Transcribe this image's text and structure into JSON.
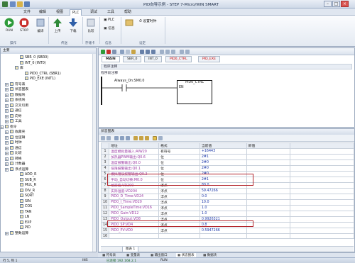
{
  "window": {
    "title": "PID向导示例 - STEP 7-Micro/WIN SMART"
  },
  "menu_tabs": [
    "文件",
    "编辑",
    "视图",
    "PLC",
    "调试",
    "工具",
    "帮助"
  ],
  "ribbon": {
    "run_label": "RUN",
    "stop_label": "STOP",
    "compile_label": "编译",
    "upload_label": "上传",
    "download_label": "下载",
    "compare_label": "比较",
    "plc_label": "PLC",
    "info_label": "信息",
    "settings_label": "设置时钟",
    "group_operation": "操作",
    "group_transfer": "传送",
    "group_memory": "存储卡",
    "group_info": "信息",
    "group_settings": "设定"
  },
  "left_panel": {
    "header": "主要",
    "tree": [
      {
        "label": "SBR_0 (SBR0)",
        "indent": 3
      },
      {
        "label": "INT_0 (INT0)",
        "indent": 3
      },
      {
        "label": "库",
        "indent": 2
      },
      {
        "label": "PID0_CTRL (SBR1)",
        "indent": 4
      },
      {
        "label": "PID_EXE (INT1)",
        "indent": 4
      },
      {
        "label": "符号表",
        "indent": 1
      },
      {
        "label": "状态图表",
        "indent": 1
      },
      {
        "label": "数据块",
        "indent": 1
      },
      {
        "label": "系统块",
        "indent": 1
      },
      {
        "label": "交叉引用",
        "indent": 1
      },
      {
        "label": "通信",
        "indent": 1
      },
      {
        "label": "向导",
        "indent": 1
      },
      {
        "label": "工具",
        "indent": 1
      },
      {
        "label": "指令",
        "indent": 0
      },
      {
        "label": "收藏夹",
        "indent": 1
      },
      {
        "label": "位逻辑",
        "indent": 1
      },
      {
        "label": "时钟",
        "indent": 1
      },
      {
        "label": "通信",
        "indent": 1
      },
      {
        "label": "比较",
        "indent": 1
      },
      {
        "label": "转换",
        "indent": 1
      },
      {
        "label": "计数器",
        "indent": 1
      },
      {
        "label": "浮点运算",
        "indent": 1
      },
      {
        "label": "ADD_R",
        "indent": 3
      },
      {
        "label": "SUB_R",
        "indent": 3
      },
      {
        "label": "MUL_R",
        "indent": 3
      },
      {
        "label": "DIV_R",
        "indent": 3
      },
      {
        "label": "SQRT",
        "indent": 3
      },
      {
        "label": "SIN",
        "indent": 3
      },
      {
        "label": "COS",
        "indent": 3
      },
      {
        "label": "TAN",
        "indent": 3
      },
      {
        "label": "LN",
        "indent": 3
      },
      {
        "label": "EXP",
        "indent": 3
      },
      {
        "label": "PID",
        "indent": 3
      },
      {
        "label": "整数运算",
        "indent": 1
      }
    ]
  },
  "editor": {
    "tabs": [
      "MAIN",
      "SBR_0",
      "INT_0",
      "PID0_CTRL",
      "PID_EXE"
    ],
    "network_comment": "程序注释",
    "network_label": "程序段注释",
    "contact_label": "Always_On:SM0.0",
    "box_label": "PID0_CTRL",
    "en_label": "EN"
  },
  "status_chart": {
    "header": "状态图表",
    "columns": [
      "地址",
      "格式",
      "当前值",
      "新值"
    ],
    "rows": [
      {
        "n": "1",
        "addr": "温度模拟量输入:AIW20",
        "fmt": "有符号",
        "val": "+16443"
      },
      {
        "n": "2",
        "addr": "加热器PWM输出:Q0.6",
        "fmt": "位",
        "val": "2#1"
      },
      {
        "n": "3",
        "addr": "温度报警输出:Q0.0",
        "fmt": "位",
        "val": "2#0"
      },
      {
        "n": "4",
        "addr": "低限报警输出:Q0.1",
        "fmt": "位",
        "val": "2#0"
      },
      {
        "n": "5",
        "addr": "模拟错误报警输出:Q0.2",
        "fmt": "位",
        "val": "2#0"
      },
      {
        "n": "6",
        "addr": "手动_自动切换:M0.0",
        "fmt": "位",
        "val": "2#1"
      },
      {
        "n": "7",
        "addr": "给定值:VD200",
        "fmt": "浮点",
        "val": "80.0"
      },
      {
        "n": "8",
        "addr": "实际温度:VD204",
        "fmt": "浮点",
        "val": "59.47266"
      },
      {
        "n": "9",
        "addr": "PID0_D_Time:VD24",
        "fmt": "浮点",
        "val": "0.0"
      },
      {
        "n": "10",
        "addr": "PID0_I_Time:VD20",
        "fmt": "浮点",
        "val": "10.0"
      },
      {
        "n": "11",
        "addr": "PID0_SampleTime:VD16",
        "fmt": "浮点",
        "val": "1.0"
      },
      {
        "n": "12",
        "addr": "PID0_Gain:VD12",
        "fmt": "浮点",
        "val": "1.0"
      },
      {
        "n": "13",
        "addr": "PID0_Output:VD8",
        "fmt": "浮点",
        "val": "0.9926321"
      },
      {
        "n": "14",
        "addr": "PID0_SP:VD4",
        "fmt": "浮点",
        "val": "0.8"
      },
      {
        "n": "15",
        "addr": "PID0_PV:VD0",
        "fmt": "浮点",
        "val": "0.5947266"
      },
      {
        "n": "16",
        "addr": "",
        "fmt": "",
        "val": ""
      }
    ],
    "sheet_tab": "图表 1"
  },
  "bottom_tabs": [
    "符号表",
    "变量表",
    "输出窗口",
    "状态图表",
    "数据块"
  ],
  "status_bar": {
    "position": "行 5, 列 1",
    "mode": "INS",
    "connection": "已连接 192.168.2.1",
    "state": "RUN"
  }
}
